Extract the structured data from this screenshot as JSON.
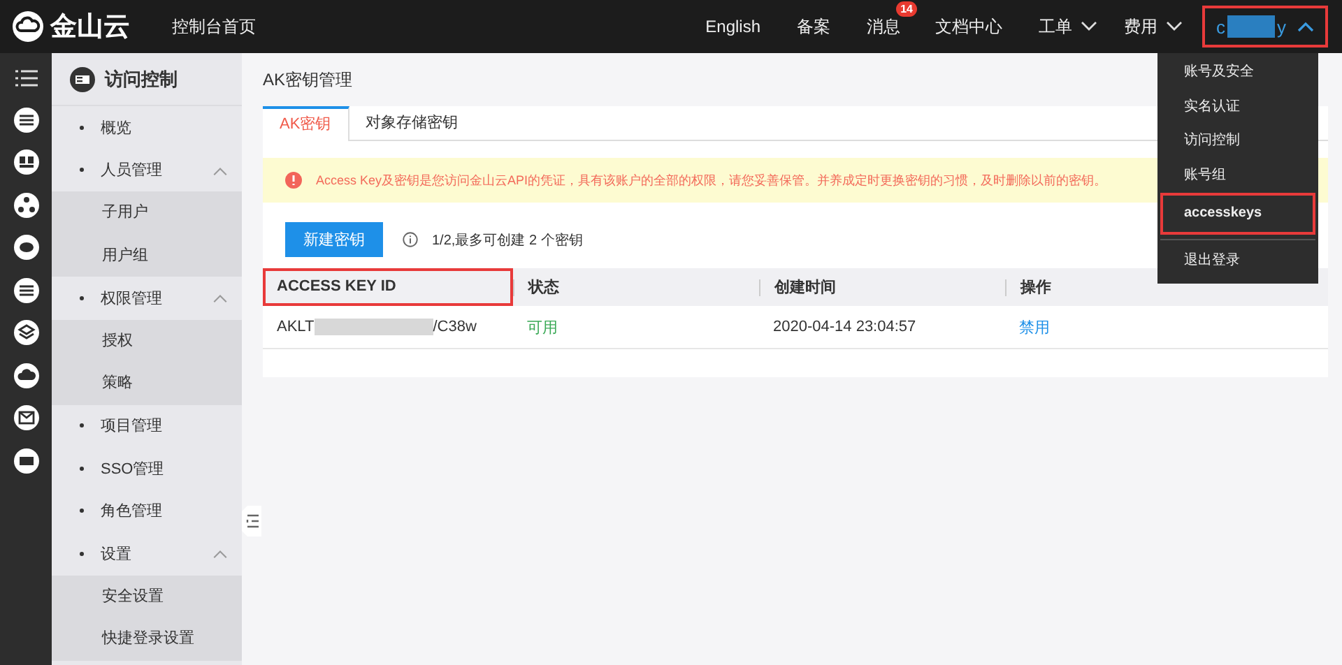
{
  "topbar": {
    "logo_text": "金山云",
    "console_link": "控制台首页",
    "nav": [
      {
        "label": "English",
        "kind": "link"
      },
      {
        "label": "备案",
        "kind": "link"
      },
      {
        "label": "消息",
        "kind": "badge",
        "badge": "14"
      },
      {
        "label": "文档中心",
        "kind": "link"
      },
      {
        "label": "工单",
        "kind": "dropdown",
        "expanded": false
      },
      {
        "label": "费用",
        "kind": "dropdown",
        "expanded": false
      }
    ],
    "user": {
      "prefix": "c",
      "suffix": "y",
      "expanded": true,
      "highlighted": true
    }
  },
  "user_menu": [
    {
      "label": "账号及安全",
      "highlighted": false
    },
    {
      "label": "实名认证",
      "highlighted": false
    },
    {
      "label": "访问控制",
      "highlighted": false
    },
    {
      "label": "账号组",
      "highlighted": false
    },
    {
      "label": "accesskeys",
      "highlighted": true
    },
    {
      "label": "退出登录",
      "highlighted": false
    }
  ],
  "sidebar": {
    "title": "访问控制",
    "items": [
      {
        "label": "概览"
      },
      {
        "label": "人员管理",
        "expanded": true,
        "children": [
          {
            "label": "子用户"
          },
          {
            "label": "用户组"
          }
        ]
      },
      {
        "label": "权限管理",
        "expanded": true,
        "children": [
          {
            "label": "授权"
          },
          {
            "label": "策略"
          }
        ]
      },
      {
        "label": "项目管理"
      },
      {
        "label": "SSO管理"
      },
      {
        "label": "角色管理"
      },
      {
        "label": "设置",
        "expanded": true,
        "children": [
          {
            "label": "安全设置"
          },
          {
            "label": "快捷登录设置"
          }
        ]
      }
    ]
  },
  "page": {
    "title": "AK密钥管理",
    "tabs": [
      {
        "label": "AK密钥",
        "selected": true
      },
      {
        "label": "对象存储密钥",
        "selected": false
      }
    ],
    "alert": "Access Key及密钥是您访问金山云API的凭证，具有该账户的全部的权限，请您妥善保管。并养成定时更换密钥的习惯，及时删除以前的密钥。",
    "create_button": "新建密钥",
    "quota_note": "1/2,最多可创建 2 个密钥",
    "table": {
      "columns": [
        {
          "label": "ACCESS KEY ID",
          "highlighted": true
        },
        {
          "label": "状态",
          "highlighted": false
        },
        {
          "label": "创建时间",
          "highlighted": false
        },
        {
          "label": "操作",
          "highlighted": false
        }
      ],
      "rows": [
        {
          "key_prefix": "AKLT",
          "key_suffix": "/C38w",
          "status": "可用",
          "created": "2020-04-14 23:04:57",
          "action": "禁用"
        }
      ]
    }
  }
}
